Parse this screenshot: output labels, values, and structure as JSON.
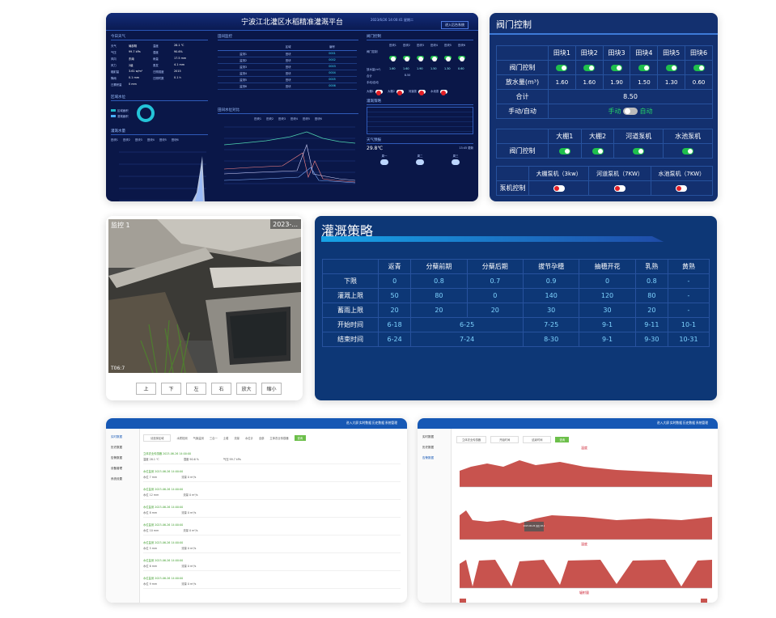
{
  "dashboard": {
    "title": "宁波江北灌区水稻精准灌溉平台",
    "datetime": "2023/6/26 14:00:41 星期二",
    "enter_button": "进入后台系统",
    "weather": {
      "title": "今日天气",
      "rows": [
        [
          "天气",
          "局部阴",
          "温度",
          "28.1 ℃"
        ],
        [
          "气压",
          "99.7 kPa",
          "湿度",
          "90.6%"
        ],
        [
          "风向",
          "东南",
          "雨量",
          "17.5 mm"
        ],
        [
          "风力",
          "2级",
          "蒸发",
          "4.1 mm"
        ],
        [
          "辐射量",
          "3.61 w/m²",
          "日照强度",
          "2015"
        ],
        [
          "降雨",
          "0.1 mm",
          "日照时数",
          "0.1 h"
        ],
        [
          "日累积量",
          "0 mm",
          "",
          ""
        ]
      ]
    },
    "region_title": "区域水位",
    "region_stat_labels": [
      "区域面积",
      "灌溉面积"
    ],
    "water_level_title": "灌溉水量",
    "water_level_series": [
      "田块1",
      "田块2",
      "田块3",
      "田块4",
      "田块5",
      "田块6"
    ],
    "monitor": {
      "title": "田间监控",
      "headers": [
        "",
        "区域",
        "编号"
      ],
      "rows": [
        [
          "监测1",
          "田块",
          "0001"
        ],
        [
          "监测2",
          "田块",
          "0002"
        ],
        [
          "监测3",
          "田块",
          "0003"
        ],
        [
          "监测4",
          "田块",
          "0004"
        ],
        [
          "监测5",
          "田块",
          "0005"
        ],
        [
          "监测6",
          "田块",
          "0006"
        ]
      ]
    },
    "trend_title": "田间水位对比",
    "trend_series": [
      "田块1",
      "田块2",
      "田块3",
      "田块4",
      "田块5",
      "田块6"
    ],
    "valve": {
      "title": "阀门控制",
      "fields": [
        "田块1",
        "田块2",
        "田块3",
        "田块4",
        "田块5",
        "田块6"
      ],
      "valve_label": "阀门控制",
      "flow_label": "放水量(m³)",
      "flows": [
        "1.60",
        "1.60",
        "1.90",
        "1.50",
        "1.30",
        "0.60"
      ],
      "total_label": "合计",
      "total": "8.50",
      "mode_label": "手动/自动"
    },
    "pumps": {
      "labels": [
        "大棚1",
        "大棚2",
        "河道泵",
        "水池泵"
      ]
    },
    "strategy_title": "灌溉策略",
    "weather_forecast": {
      "title": "天气预报",
      "temp": "29.8℃",
      "items": [
        "周一",
        "周二",
        "周三"
      ]
    },
    "footer": "13:45 更新"
  },
  "valve_panel": {
    "title": "阀门控制",
    "fields": [
      "田块1",
      "田块2",
      "田块3",
      "田块4",
      "田块5",
      "田块6"
    ],
    "valve_label": "阀门控制",
    "flow_label": "放水量(m³)",
    "flows": [
      "1.60",
      "1.60",
      "1.90",
      "1.50",
      "1.30",
      "0.60"
    ],
    "total_label": "合计",
    "total": "8.50",
    "mode_label": "手动/自动",
    "mode_manual": "手动",
    "mode_auto": "自动",
    "sheds": [
      "大棚1",
      "大棚2",
      "河道泵机",
      "水池泵机"
    ],
    "pump_labels": [
      "大棚泵机（3kw）",
      "河道泵机（7KW）",
      "水池泵机（7KW）"
    ],
    "pump_control": "泵机控制"
  },
  "video": {
    "timestamp_left": "监控 1",
    "timestamp_right": "2023-...",
    "corner_time": "T06:7",
    "buttons": [
      "上",
      "下",
      "左",
      "右",
      "放大",
      "缩小"
    ]
  },
  "strategy": {
    "title": "灌溉策略",
    "headers": [
      "",
      "返青",
      "分蘖前期",
      "分蘖后期",
      "拔节孕穗",
      "抽穗开花",
      "乳熟",
      "黄熟"
    ],
    "rows": [
      {
        "label": "下限",
        "cells": [
          "0",
          "0.8",
          "0.7",
          "0.9",
          "0",
          "0.8",
          "-"
        ]
      },
      {
        "label": "灌溉上限",
        "cells": [
          "50",
          "80",
          "0",
          "140",
          "120",
          "80",
          "-"
        ]
      },
      {
        "label": "蓄雨上限",
        "cells": [
          "20",
          "20",
          "20",
          "30",
          "30",
          "20",
          "-"
        ]
      },
      {
        "label": "开始时间",
        "cells": [
          "6-18",
          "6-25",
          "7-25",
          "9-1",
          "9-11",
          "10-1"
        ]
      },
      {
        "label": "结束时间",
        "cells": [
          "6-24",
          "7-24",
          "8-30",
          "9-1",
          "9-30",
          "10-31"
        ]
      }
    ]
  },
  "admin_left": {
    "nav": [
      "进入大屏",
      "实时数据",
      "历史数据",
      "系统管理"
    ],
    "side": [
      "实时数据",
      "历史数据",
      "告警数据",
      "设备管理",
      "系统设置"
    ],
    "filters": [
      "请选择区域",
      "水质检测",
      "气象监测",
      "三合一",
      "土壤",
      "流量",
      "水位计",
      "全部",
      "立体农业传感器",
      "查询"
    ],
    "records": [
      {
        "title": "立体农业传感器 2023-06-26 14:00:00",
        "a": "温度 28.1 ℃",
        "b": "湿度 90.6 %",
        "c": "气压 99.7 kPa"
      },
      {
        "title": "水位监测 2023-06-26 14:00:00",
        "a": "水位 7 mm",
        "b": "流量 0 m³/s",
        "c": ""
      },
      {
        "title": "水位监测 2023-06-26 14:00:00",
        "a": "水位 12 mm",
        "b": "流量 0 m³/s",
        "c": ""
      },
      {
        "title": "水位监测 2023-06-26 14:00:00",
        "a": "水位 8 mm",
        "b": "流量 0 m³/s",
        "c": ""
      },
      {
        "title": "水位监测 2023-06-26 14:00:00",
        "a": "水位 10 mm",
        "b": "流量 0 m³/s",
        "c": ""
      },
      {
        "title": "水位监测 2023-06-26 14:00:00",
        "a": "水位 5 mm",
        "b": "流量 0 m³/s",
        "c": ""
      },
      {
        "title": "水位监测 2023-06-26 14:00:00",
        "a": "水位 6 mm",
        "b": "流量 0 m³/s",
        "c": ""
      },
      {
        "title": "水位监测 2023-06-26 14:00:00",
        "a": "水位 9 mm",
        "b": "流量 0 m³/s",
        "c": ""
      }
    ]
  },
  "admin_right": {
    "nav": [
      "进入大屏",
      "实时数据",
      "历史数据",
      "系统管理"
    ],
    "side": [
      "实时数据",
      "历史数据",
      "告警数据"
    ],
    "filters": [
      "立体农业传感器",
      "开始时间",
      "结束时间",
      "查询"
    ],
    "legend": [
      "温度",
      "湿度",
      "辐射量"
    ],
    "tooltip": "2023-06-26 温度 28.1"
  }
}
